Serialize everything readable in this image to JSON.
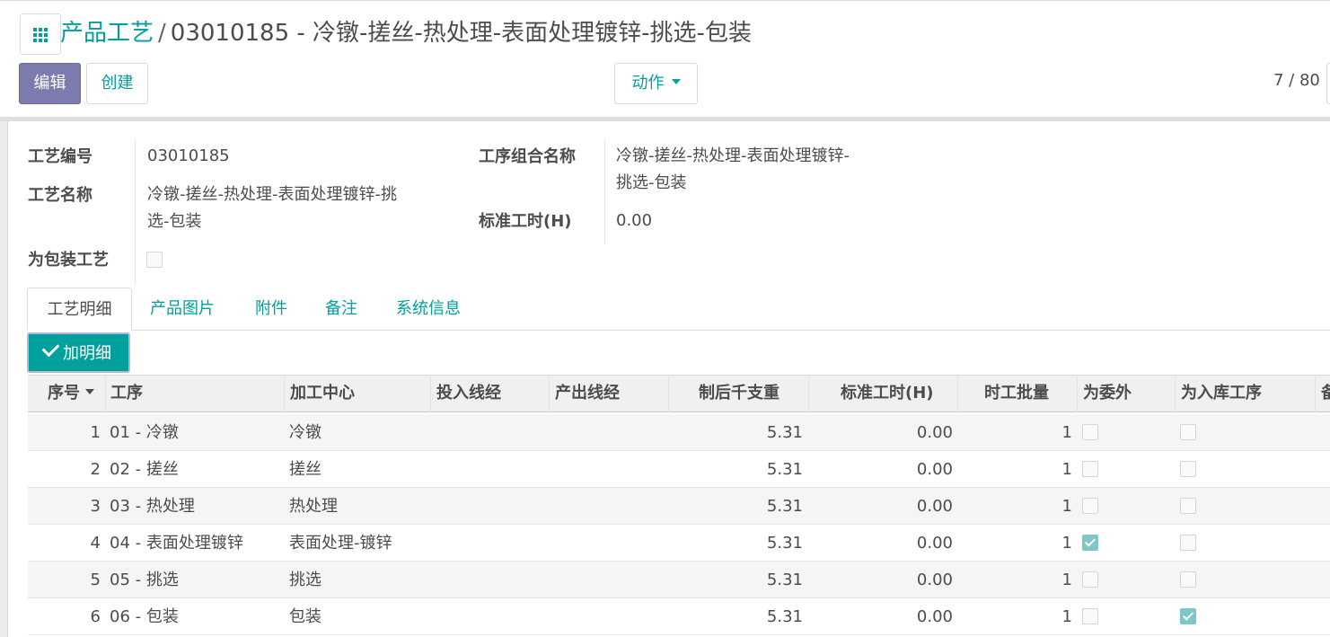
{
  "breadcrumb": {
    "parent": "产品工艺",
    "separator": "/",
    "current": "03010185 - 冷镦-搓丝-热处理-表面处理镀锌-挑选-包装"
  },
  "toolbar": {
    "edit_label": "编辑",
    "create_label": "创建",
    "action_label": "动作",
    "pager": "7 / 80"
  },
  "form": {
    "code_label": "工艺编号",
    "code_value": "03010185",
    "name_label": "工艺名称",
    "name_value_line1": "冷镦-搓丝-热处理-表面处理镀锌-挑",
    "name_value_line2": "选-包装",
    "packaging_label": "为包装工艺",
    "packaging_checked": false,
    "group_label": "工序组合名称",
    "group_value_line1": "冷镦-搓丝-热处理-表面处理镀锌-",
    "group_value_line2": "挑选-包装",
    "std_hours_label": "标准工时(H)",
    "std_hours_value": "0.00"
  },
  "tabs": [
    "工艺明细",
    "产品图片",
    "附件",
    "备注",
    "系统信息"
  ],
  "add_button_label": "加明细",
  "table": {
    "columns": [
      "序号",
      "工序",
      "加工中心",
      "投入线经",
      "产出线经",
      "制后千支重",
      "标准工时(H)",
      "时工批量",
      "为委外",
      "为入库工序",
      "备"
    ],
    "rows": [
      {
        "seq": "1",
        "process": "01 - 冷镦",
        "center": "冷镦",
        "weight": "5.31",
        "hours": "0.00",
        "batch": "1",
        "outsourced": false,
        "storage": false
      },
      {
        "seq": "2",
        "process": "02 - 搓丝",
        "center": "搓丝",
        "weight": "5.31",
        "hours": "0.00",
        "batch": "1",
        "outsourced": false,
        "storage": false
      },
      {
        "seq": "3",
        "process": "03 - 热处理",
        "center": "热处理",
        "weight": "5.31",
        "hours": "0.00",
        "batch": "1",
        "outsourced": false,
        "storage": false
      },
      {
        "seq": "4",
        "process": "04 - 表面处理镀锌",
        "center": "表面处理-镀锌",
        "weight": "5.31",
        "hours": "0.00",
        "batch": "1",
        "outsourced": true,
        "storage": false
      },
      {
        "seq": "5",
        "process": "05 - 挑选",
        "center": "挑选",
        "weight": "5.31",
        "hours": "0.00",
        "batch": "1",
        "outsourced": false,
        "storage": false
      },
      {
        "seq": "6",
        "process": "06 - 包装",
        "center": "包装",
        "weight": "5.31",
        "hours": "0.00",
        "batch": "1",
        "outsourced": false,
        "storage": true
      }
    ]
  },
  "colors": {
    "primary": "#7c7bad",
    "link": "#00a09d",
    "checkbox_checked": "#7fc7c6"
  },
  "icons": {
    "apps": "apps-grid-icon",
    "add": "check-icon",
    "sort": "sort-caret-icon",
    "dropdown": "caret-down-icon"
  }
}
